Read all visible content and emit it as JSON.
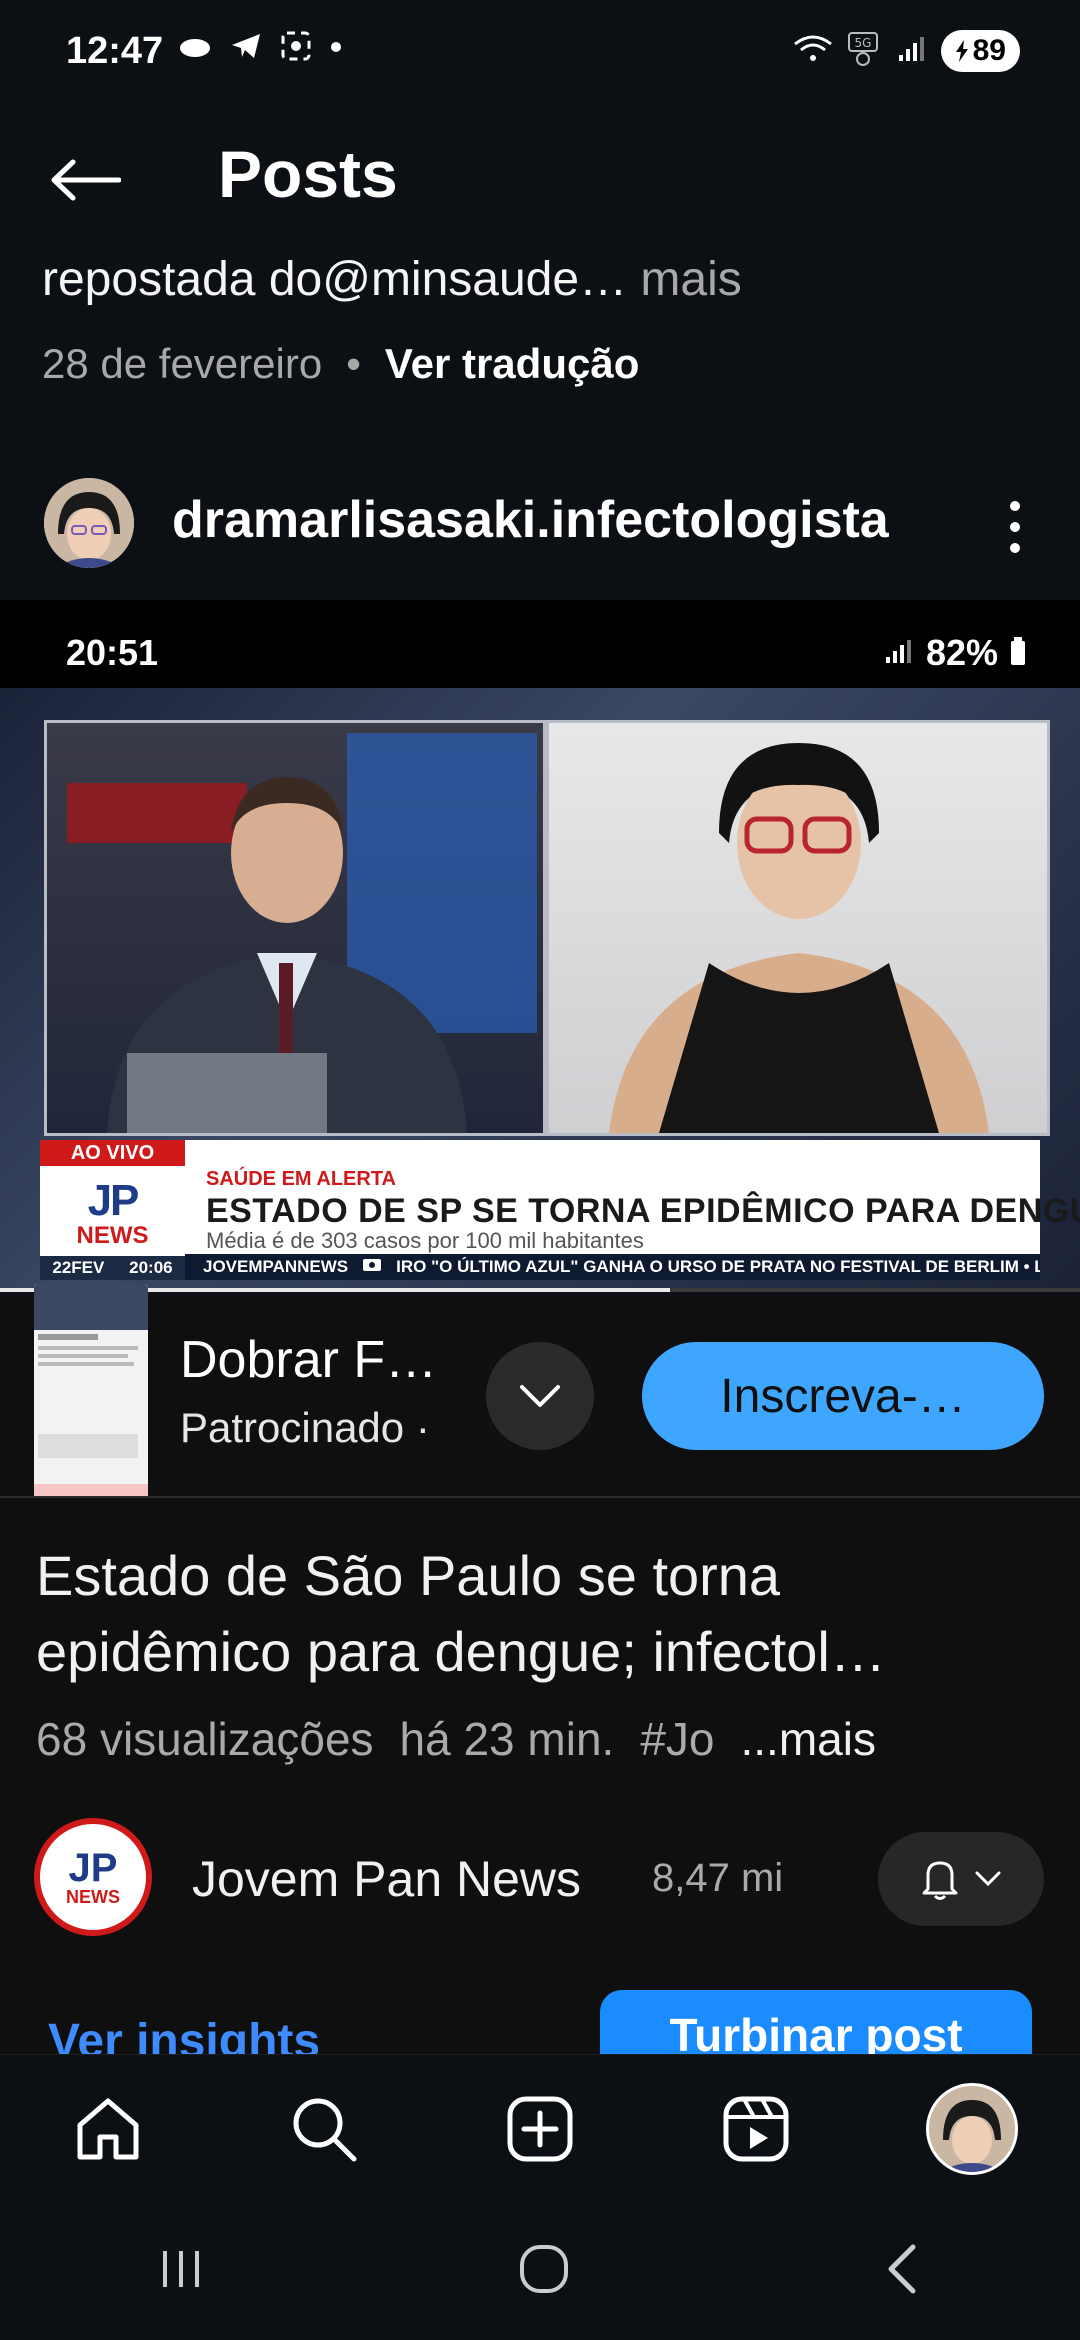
{
  "status_bar": {
    "time": "12:47",
    "battery": "89"
  },
  "header": {
    "title": "Posts"
  },
  "post": {
    "caption": "repostada do@minsaude…",
    "caption_more": "mais",
    "date": "28 de fevereiro",
    "translate": "Ver tradução",
    "username": "dramarlisasaki.infectologista"
  },
  "media": {
    "inner_time": "20:51",
    "inner_battery": "82%",
    "ao_vivo": "AO VIVO",
    "logo_jp": "JP",
    "logo_news": "NEWS",
    "date_day": "22FEV",
    "date_time": "20:06",
    "kicker": "SAÚDE EM ALERTA",
    "headline": "ESTADO DE SP SE TORNA EPIDÊMICO PARA DENGUE",
    "subline": "Média é de 303 casos por 100 mil habitantes",
    "ticker_source": "JOVEMPANNEWS",
    "ticker_text": "IRO \"O ÚLTIMO AZUL\" GANHA O URSO DE PRATA NO FESTIVAL DE BERLIM • LULA DI",
    "progress": 0.62
  },
  "ad": {
    "title": "Dobrar F…",
    "subtitle": "Patrocinado ·",
    "subscribe": "Inscreva-…"
  },
  "video": {
    "title": "Estado de São Paulo se torna epidêmico para dengue; infectol…",
    "views": "68 visualizações",
    "time_ago": "há 23 min.",
    "hashtag": "#Jo",
    "more": "...mais",
    "channel": "Jovem Pan News",
    "subscribers": "8,47 mi"
  },
  "actions": {
    "insights": "Ver insights",
    "boost": "Turbinar post"
  },
  "bottom_nav": [
    "home-icon",
    "search-icon",
    "create-icon",
    "reels-icon",
    "profile-avatar"
  ],
  "colors": {
    "background": "#0c1014",
    "accent_blue": "#3ea6ff",
    "jp_red": "#d01a1a",
    "jp_blue": "#1f3c86"
  }
}
